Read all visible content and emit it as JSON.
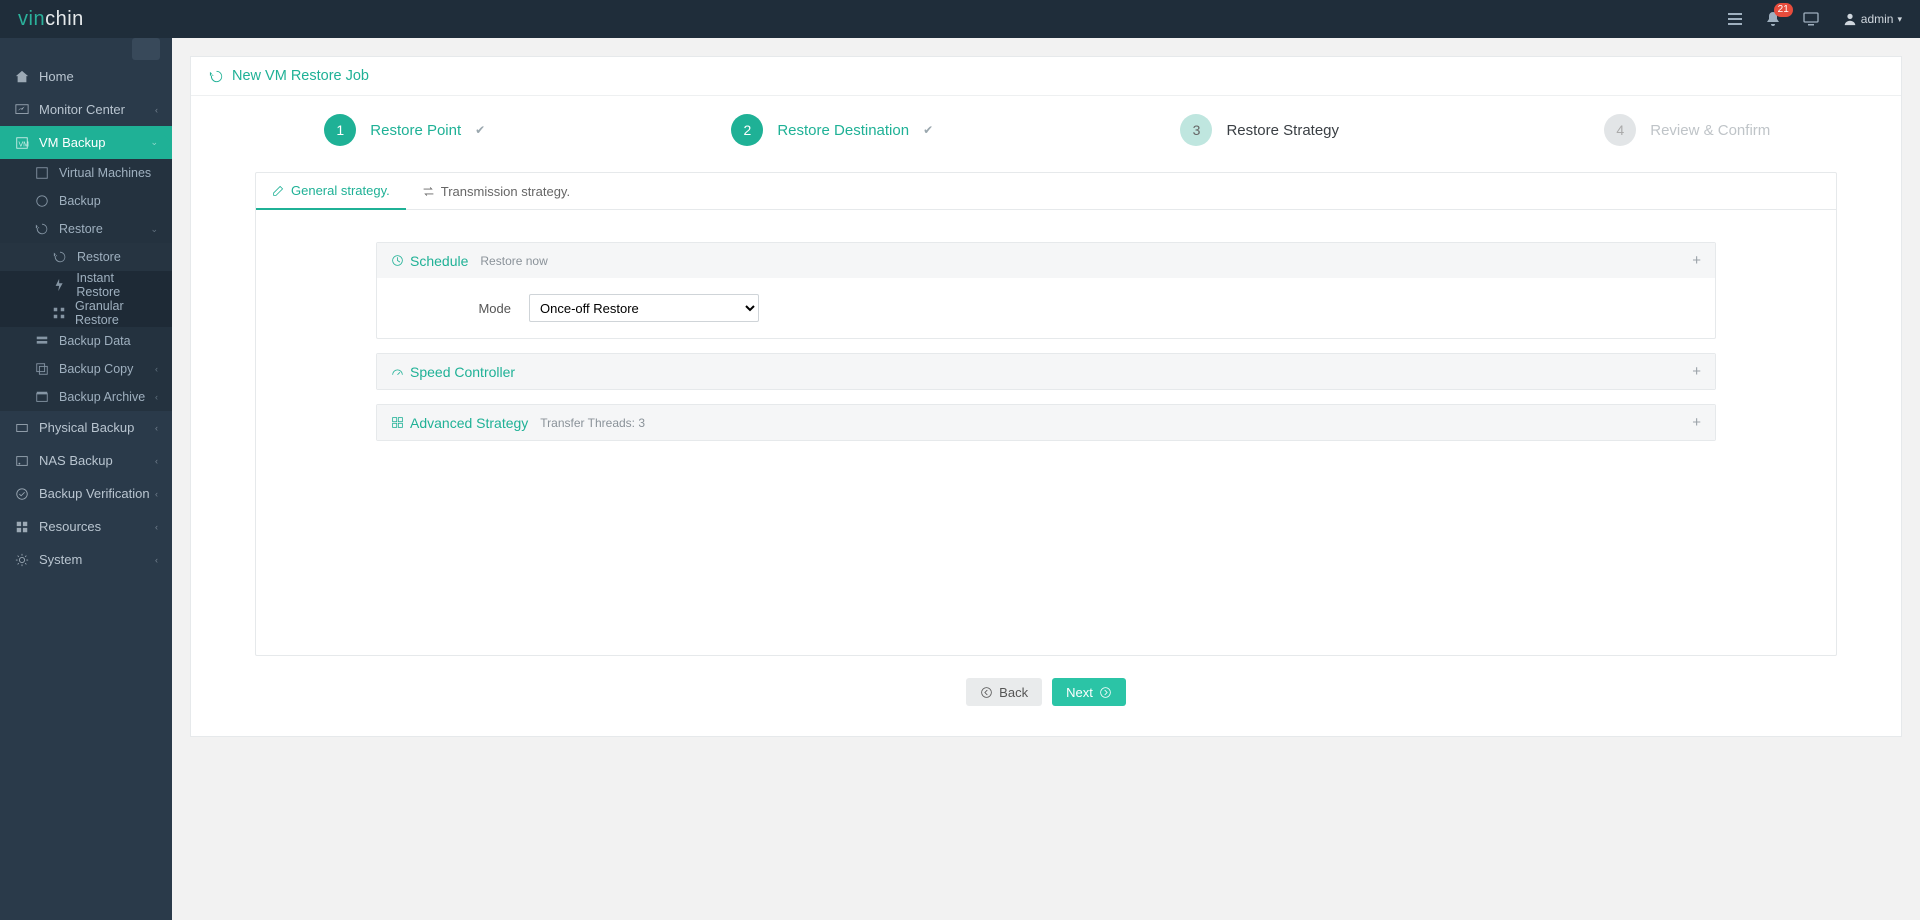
{
  "brand": {
    "part1": "vin",
    "part2": "chin"
  },
  "topbar": {
    "notif_count": "21",
    "user": "admin"
  },
  "sidebar": {
    "items": [
      {
        "label": "Home"
      },
      {
        "label": "Monitor Center"
      },
      {
        "label": "VM Backup",
        "children": [
          {
            "label": "Virtual Machines"
          },
          {
            "label": "Backup"
          },
          {
            "label": "Restore",
            "children": [
              {
                "label": "Restore"
              },
              {
                "label": "Instant Restore"
              },
              {
                "label": "Granular Restore"
              }
            ]
          },
          {
            "label": "Backup Data"
          },
          {
            "label": "Backup Copy"
          },
          {
            "label": "Backup Archive"
          }
        ]
      },
      {
        "label": "Physical Backup"
      },
      {
        "label": "NAS Backup"
      },
      {
        "label": "Backup Verification"
      },
      {
        "label": "Resources"
      },
      {
        "label": "System"
      }
    ]
  },
  "page": {
    "title": "New VM Restore Job"
  },
  "wizard": {
    "steps": [
      {
        "n": "1",
        "label": "Restore Point"
      },
      {
        "n": "2",
        "label": "Restore Destination"
      },
      {
        "n": "3",
        "label": "Restore Strategy"
      },
      {
        "n": "4",
        "label": "Review & Confirm"
      }
    ]
  },
  "tabs": {
    "general": "General strategy.",
    "transmission": "Transmission strategy."
  },
  "schedule": {
    "title": "Schedule",
    "summary": "Restore now",
    "mode_label": "Mode",
    "mode_value": "Once-off Restore"
  },
  "speed": {
    "title": "Speed Controller"
  },
  "advanced": {
    "title": "Advanced Strategy",
    "summary": "Transfer Threads: 3"
  },
  "buttons": {
    "back": "Back",
    "next": "Next"
  }
}
